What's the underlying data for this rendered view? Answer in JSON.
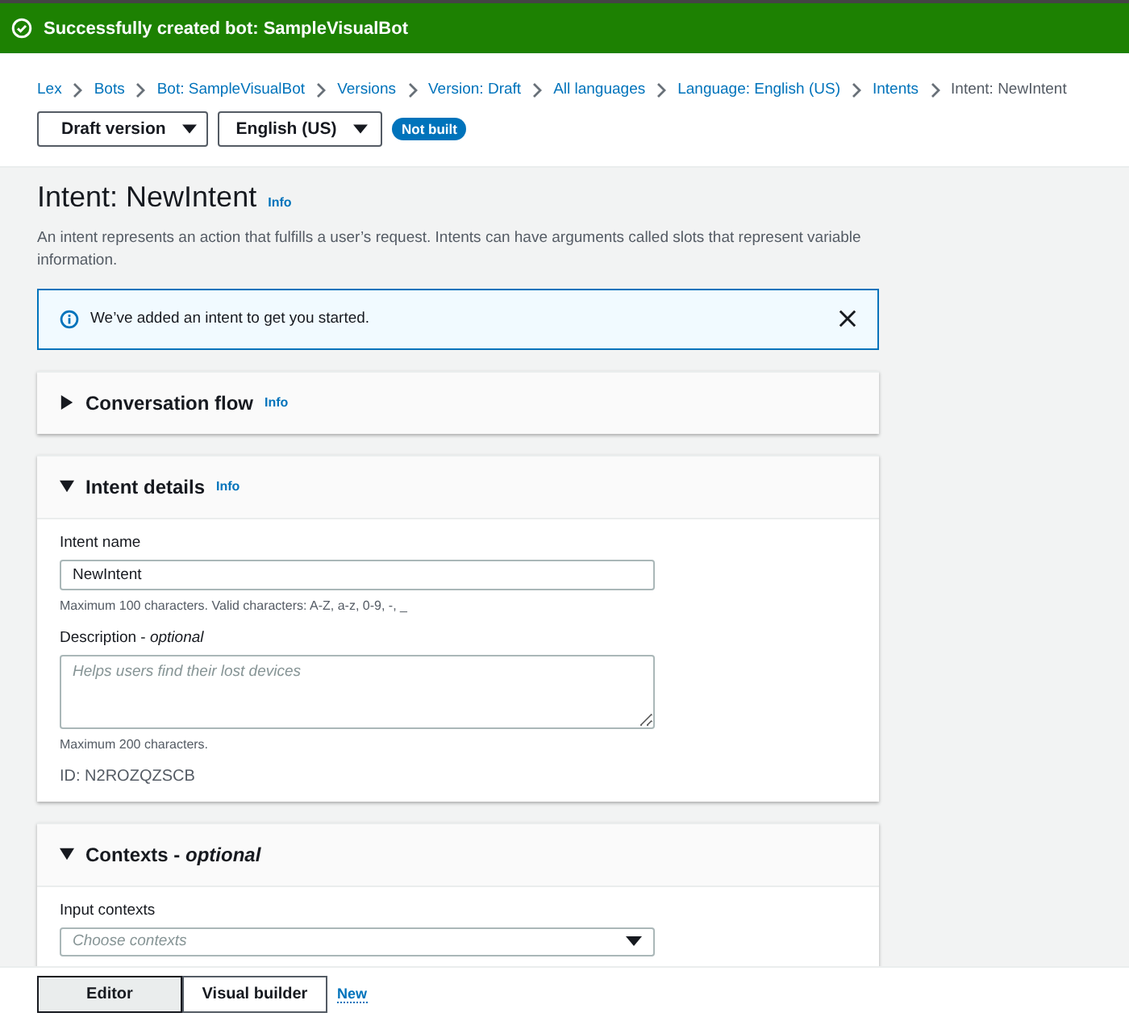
{
  "flash": {
    "message": "Successfully created bot: SampleVisualBot"
  },
  "breadcrumbs": [
    {
      "label": "Lex",
      "link": true
    },
    {
      "label": "Bots",
      "link": true
    },
    {
      "label": "Bot: SampleVisualBot",
      "link": true
    },
    {
      "label": "Versions",
      "link": true
    },
    {
      "label": "Version: Draft",
      "link": true
    },
    {
      "label": "All languages",
      "link": true
    },
    {
      "label": "Language: English (US)",
      "link": true
    },
    {
      "label": "Intents",
      "link": true
    },
    {
      "label": "Intent: NewIntent",
      "link": false
    }
  ],
  "selectors": [
    {
      "label": "Draft version"
    },
    {
      "label": "English (US)"
    }
  ],
  "build_badge": "Not built",
  "page": {
    "title": "Intent: NewIntent",
    "info": "Info",
    "description": "An intent represents an action that fulfills a user’s request. Intents can have arguments called slots that represent variable information."
  },
  "alert": {
    "message": "We’ve added an intent to get you started."
  },
  "sections": [
    {
      "title": "Conversation flow",
      "info": "Info",
      "expanded": false
    },
    {
      "title": "Intent details",
      "info": "Info",
      "expanded": true,
      "fields": [
        {
          "kind": "input",
          "label": "Intent name",
          "value": "NewIntent",
          "hint": "Maximum 100 characters. Valid characters: A-Z, a-z, 0-9, -, _"
        },
        {
          "kind": "textarea",
          "label": "Description - *optional*",
          "placeholder": "Helps users find their lost devices",
          "hint": "Maximum 200 characters."
        }
      ],
      "id_text": "ID: N2ROZQZSCB"
    },
    {
      "title": "Contexts - *optional*",
      "expanded": true,
      "fields": [
        {
          "kind": "select",
          "label": "Input contexts",
          "placeholder": "Choose contexts"
        }
      ]
    }
  ],
  "footer": {
    "tabs": [
      {
        "label": "Editor",
        "selected": true
      },
      {
        "label": "Visual builder",
        "selected": false
      }
    ],
    "new_link": "New"
  }
}
